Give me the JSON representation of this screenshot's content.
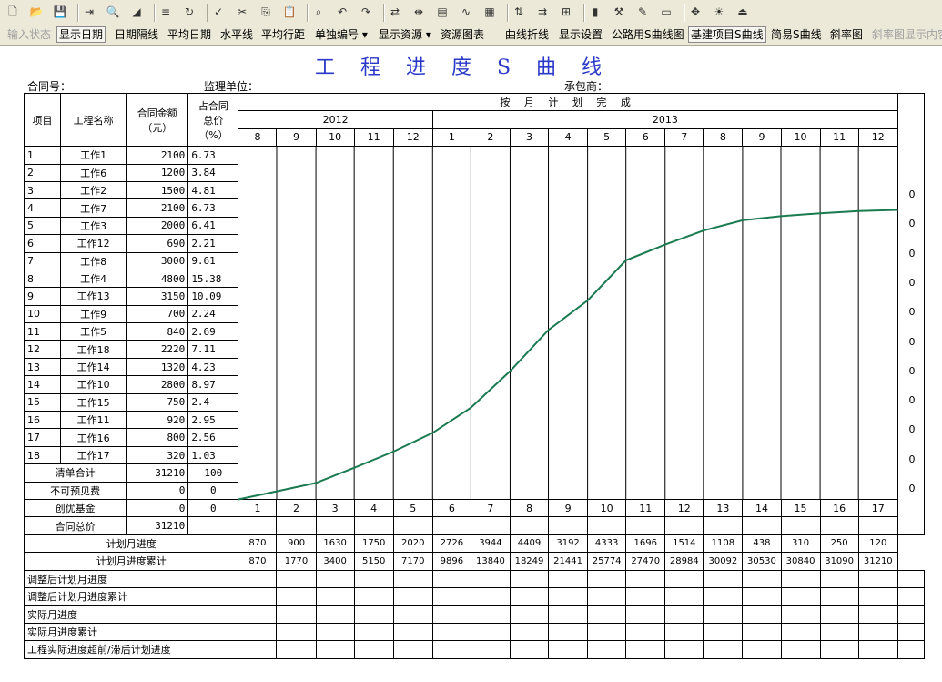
{
  "toolbar1": {
    "icons": [
      "new-icon",
      "open-icon",
      "save-icon",
      "import-icon",
      "print-preview-icon",
      "fill-icon",
      "align-icon",
      "refresh-icon",
      "check-icon",
      "cut-icon",
      "copy-icon",
      "paste-icon",
      "find-icon",
      "undo-icon",
      "redo-icon",
      "link-icon",
      "split-icon",
      "table-icon",
      "curve-icon",
      "chart-icon",
      "merge-icon",
      "insert-icon",
      "format-icon",
      "bars-icon",
      "tool-icon",
      "draw-icon",
      "frame-icon",
      "move-icon",
      "lightbulb-icon",
      "exit-icon"
    ]
  },
  "toolbar2": {
    "items": [
      {
        "label": "输入状态",
        "state": "disabled"
      },
      {
        "label": "显示日期",
        "state": "pressed"
      },
      {
        "label": "日期隔线",
        "state": "normal"
      },
      {
        "label": "平均日期",
        "state": "normal"
      },
      {
        "label": "水平线",
        "state": "normal"
      },
      {
        "label": "平均行距",
        "state": "normal"
      },
      {
        "label": "单独编号 ▾",
        "state": "normal"
      },
      {
        "label": "显示资源 ▾",
        "state": "normal"
      },
      {
        "label": "资源图表",
        "state": "normal"
      },
      {
        "label": "曲线折线",
        "state": "normal"
      },
      {
        "label": "显示设置",
        "state": "normal"
      },
      {
        "label": "公路用S曲线图",
        "state": "normal"
      },
      {
        "label": "基建项目S曲线",
        "state": "pressed"
      },
      {
        "label": "简易S曲线",
        "state": "normal"
      },
      {
        "label": "斜率图",
        "state": "normal"
      },
      {
        "label": "斜率图显示内容",
        "state": "disabled"
      }
    ]
  },
  "sheet": {
    "title": "工程进度S曲线",
    "contract_no_label": "合同号：",
    "supervisor_label": "监理单位：",
    "contractor_label": "承包商：",
    "headers": {
      "item": "项目",
      "name": "工程名称",
      "amount_line1": "合同金额",
      "amount_line2": "（元）",
      "ratio_line1": "占合同",
      "ratio_line2": "总价",
      "ratio_line3": "（%）",
      "plan": "按 月 计 划 完 成",
      "year1": "2012",
      "year2": "2013"
    },
    "months": [
      "8",
      "9",
      "10",
      "11",
      "12",
      "1",
      "2",
      "3",
      "4",
      "5",
      "6",
      "7",
      "8",
      "9",
      "10",
      "11",
      "12"
    ],
    "rows": [
      {
        "no": "1",
        "name": "工作1",
        "amount": "2100",
        "ratio": "6.73"
      },
      {
        "no": "2",
        "name": "工作6",
        "amount": "1200",
        "ratio": "3.84"
      },
      {
        "no": "3",
        "name": "工作2",
        "amount": "1500",
        "ratio": "4.81"
      },
      {
        "no": "4",
        "name": "工作7",
        "amount": "2100",
        "ratio": "6.73"
      },
      {
        "no": "5",
        "name": "工作3",
        "amount": "2000",
        "ratio": "6.41"
      },
      {
        "no": "6",
        "name": "工作12",
        "amount": "690",
        "ratio": "2.21"
      },
      {
        "no": "7",
        "name": "工作8",
        "amount": "3000",
        "ratio": "9.61"
      },
      {
        "no": "8",
        "name": "工作4",
        "amount": "4800",
        "ratio": "15.38"
      },
      {
        "no": "9",
        "name": "工作13",
        "amount": "3150",
        "ratio": "10.09"
      },
      {
        "no": "10",
        "name": "工作9",
        "amount": "700",
        "ratio": "2.24"
      },
      {
        "no": "11",
        "name": "工作5",
        "amount": "840",
        "ratio": "2.69"
      },
      {
        "no": "12",
        "name": "工作18",
        "amount": "2220",
        "ratio": "7.11"
      },
      {
        "no": "13",
        "name": "工作14",
        "amount": "1320",
        "ratio": "4.23"
      },
      {
        "no": "14",
        "name": "工作10",
        "amount": "2800",
        "ratio": "8.97"
      },
      {
        "no": "15",
        "name": "工作15",
        "amount": "750",
        "ratio": "2.4"
      },
      {
        "no": "16",
        "name": "工作11",
        "amount": "920",
        "ratio": "2.95"
      },
      {
        "no": "17",
        "name": "工作16",
        "amount": "800",
        "ratio": "2.56"
      },
      {
        "no": "18",
        "name": "工作17",
        "amount": "320",
        "ratio": "1.03"
      }
    ],
    "summary": [
      {
        "label": "清单合计",
        "amount": "31210",
        "ratio": "100"
      },
      {
        "label": "不可预见费",
        "amount": "0",
        "ratio": "0"
      },
      {
        "label": "创优基金",
        "amount": "0",
        "ratio": "0"
      },
      {
        "label": "合同总价",
        "amount": "31210",
        "ratio": ""
      }
    ],
    "periods": [
      "1",
      "2",
      "3",
      "4",
      "5",
      "6",
      "7",
      "8",
      "9",
      "10",
      "11",
      "12",
      "13",
      "14",
      "15",
      "16",
      "17"
    ],
    "monthly_label": "计划月进度",
    "monthly": [
      "870",
      "900",
      "1630",
      "1750",
      "2020",
      "2726",
      "3944",
      "4409",
      "3192",
      "4333",
      "1696",
      "1514",
      "1108",
      "438",
      "310",
      "250",
      "120"
    ],
    "cumulative_label": "计划月进度累计",
    "cumulative": [
      "870",
      "1770",
      "3400",
      "5150",
      "7170",
      "9896",
      "13840",
      "18249",
      "21441",
      "25774",
      "27470",
      "28984",
      "30092",
      "30530",
      "30840",
      "31090",
      "31210"
    ],
    "extra_rows": [
      "调整后计划月进度",
      "调整后计划月进度累计",
      "实际月进度",
      "实际月进度累计",
      "工程实际进度超前/滞后计划进度"
    ],
    "side_values": [
      "0",
      "0",
      "0",
      "0",
      "0",
      "0",
      "0",
      "0",
      "0",
      "0",
      "0"
    ],
    "curve_color": "#1a7a50"
  },
  "chart_data": {
    "type": "line",
    "title": "工程进度S曲线",
    "xlabel": "",
    "ylabel": "",
    "x": [
      0,
      1,
      2,
      3,
      4,
      5,
      6,
      7,
      8,
      9,
      10,
      11,
      12,
      13,
      14,
      15,
      16,
      17
    ],
    "series": [
      {
        "values": [
          0,
          870,
          1770,
          3400,
          5150,
          7170,
          9896,
          13840,
          18249,
          21441,
          25774,
          27470,
          28984,
          30092,
          30530,
          30840,
          31090,
          31210
        ]
      }
    ],
    "ylim": [
      0,
      31210
    ]
  }
}
